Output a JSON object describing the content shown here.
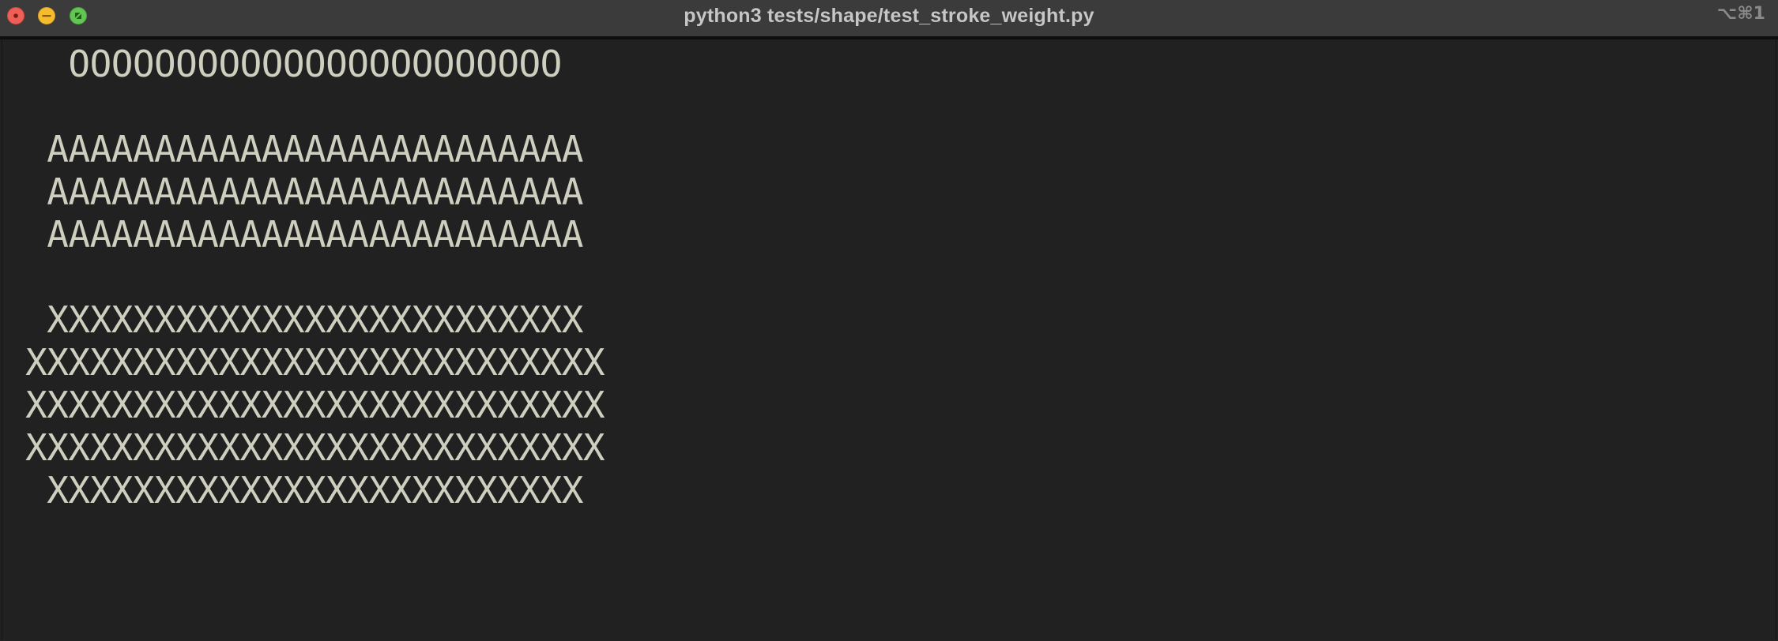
{
  "window": {
    "title": "python3 tests/shape/test_stroke_weight.py",
    "shortcut": "⌥⌘1"
  },
  "terminal": {
    "lines": [
      "   OOOOOOOOOOOOOOOOOOOOOOO",
      "",
      "  AAAAAAAAAAAAAAAAAAAAAAAAA",
      "  AAAAAAAAAAAAAAAAAAAAAAAAA",
      "  AAAAAAAAAAAAAAAAAAAAAAAAA",
      "",
      "  XXXXXXXXXXXXXXXXXXXXXXXXX",
      " XXXXXXXXXXXXXXXXXXXXXXXXXXX",
      " XXXXXXXXXXXXXXXXXXXXXXXXXXX",
      " XXXXXXXXXXXXXXXXXXXXXXXXXXX",
      "  XXXXXXXXXXXXXXXXXXXXXXXXX"
    ]
  },
  "colors": {
    "text": "#cfcfc0",
    "background": "#212121",
    "titlebar": "#3b3b3b",
    "close": "#ee5f57",
    "minimize": "#f5bd2e",
    "maximize": "#62c554"
  }
}
